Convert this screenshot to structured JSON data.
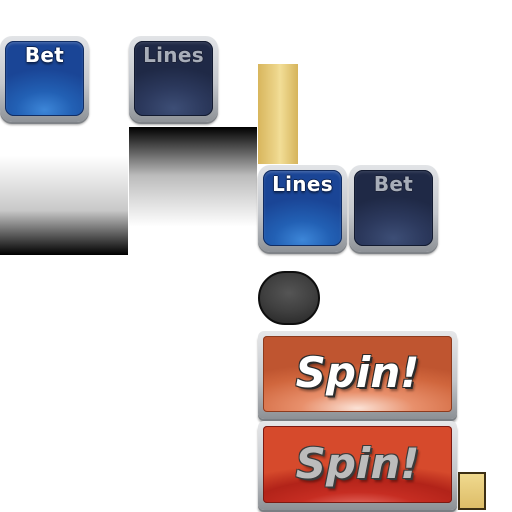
{
  "buttons": {
    "bet_active": {
      "label": "Bet"
    },
    "lines_dim": {
      "label": "Lines"
    },
    "lines_active": {
      "label": "Lines"
    },
    "bet_dim": {
      "label": "Bet"
    },
    "spin_hover": {
      "label": "Spin!"
    },
    "spin_normal": {
      "label": "Spin!"
    }
  },
  "colors": {
    "button_blue": "#2260b4",
    "button_dim_blue": "#2c395d",
    "spin_orange": "#d0663d",
    "spin_red": "#c62d22",
    "gold_bar": "#e8cb7a",
    "dark_pill": "#3c3c3c"
  }
}
